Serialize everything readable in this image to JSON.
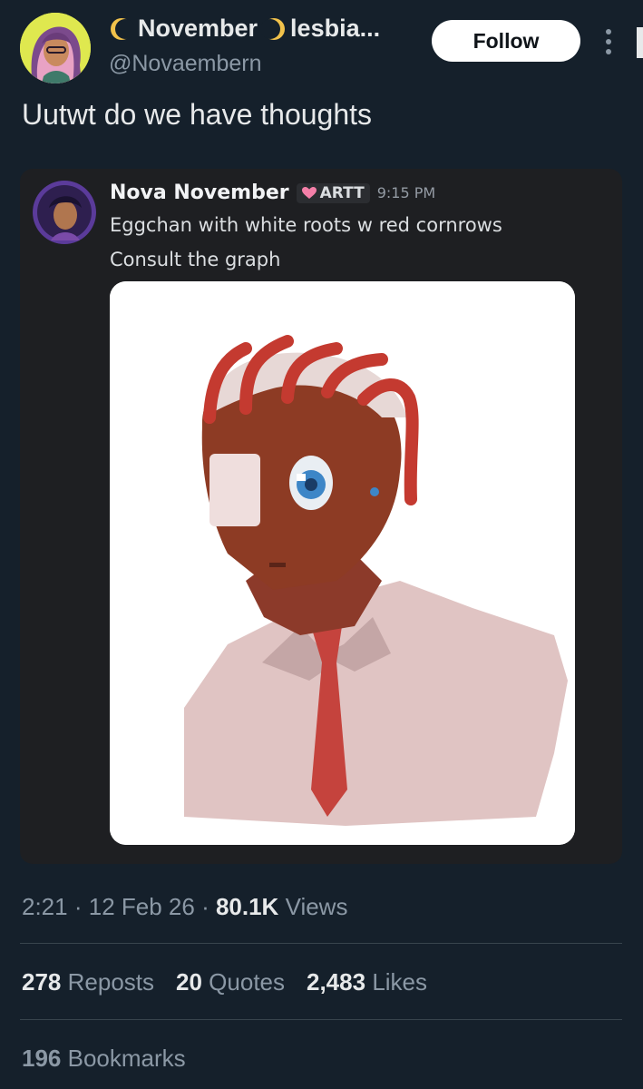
{
  "author": {
    "display_name": "November",
    "display_name_suffix": "lesbia...",
    "handle": "@Novaembern"
  },
  "follow_label": "Follow",
  "tweet_text": "Uutwt do we have thoughts",
  "embed": {
    "username": "Nova November",
    "tag": "ARTT",
    "time": "9:15 PM",
    "lines": [
      "Eggchan with white roots w red cornrows",
      "Consult the graph"
    ]
  },
  "meta": {
    "time": "2:21",
    "date": "12 Feb 26",
    "views_count": "80.1K",
    "views_label": "Views"
  },
  "stats": {
    "reposts_count": "278",
    "reposts_label": "Reposts",
    "quotes_count": "20",
    "quotes_label": "Quotes",
    "likes_count": "2,483",
    "likes_label": "Likes",
    "bookmarks_count": "196",
    "bookmarks_label": "Bookmarks"
  },
  "colors": {
    "background": "#15202b",
    "card": "#1e1f22",
    "muted_text": "#8b98a5",
    "tag_heart": "#f47fa8"
  }
}
